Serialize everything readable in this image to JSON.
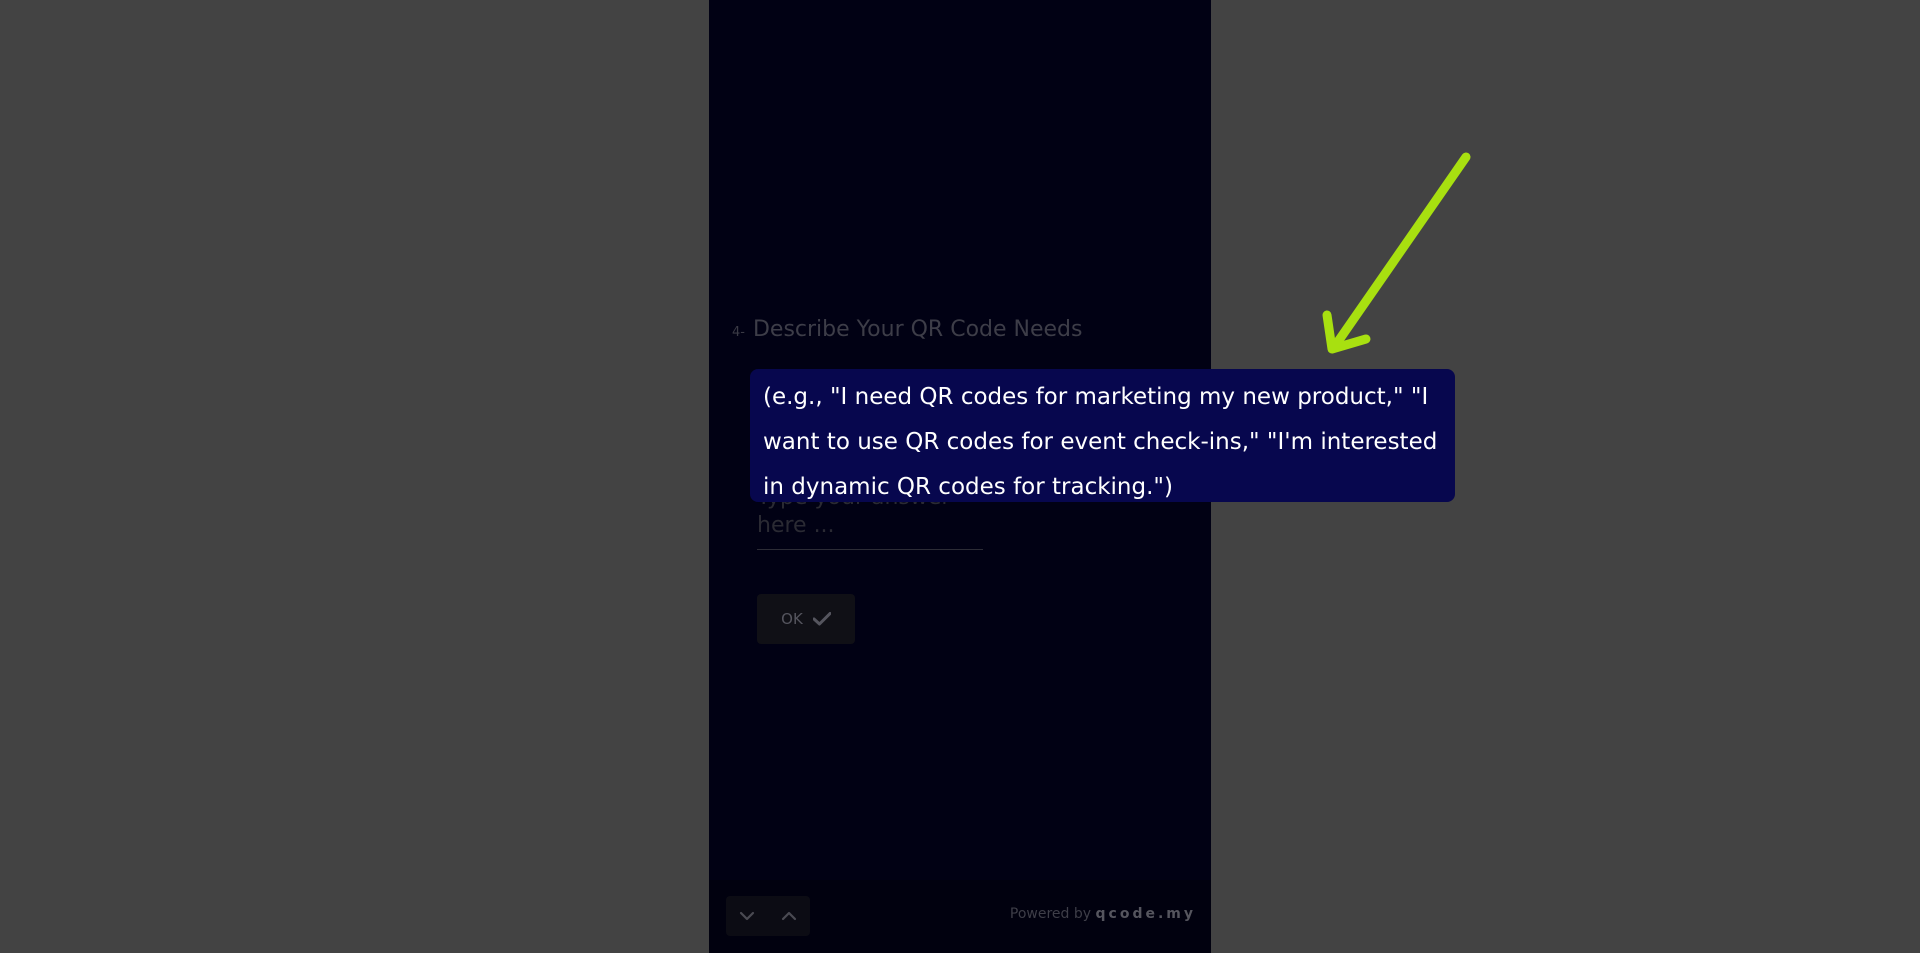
{
  "question": {
    "number": "4-",
    "title": "Describe Your QR Code Needs"
  },
  "answer": {
    "placeholder": "Type your answer here ..."
  },
  "ok_button": {
    "label": "OK",
    "icon": "check-icon"
  },
  "footer": {
    "powered_prefix": "Powered by",
    "brand": "qcode.my",
    "nav_down_icon": "chevron-down-icon",
    "nav_up_icon": "chevron-up-icon"
  },
  "tooltip": {
    "text": "(e.g., \"I need QR codes for marketing my new product,\" \"I want to use QR codes for event check-ins,\" \"I'm interested in dynamic QR codes for tracking.\")"
  },
  "colors": {
    "backdrop": "#434343",
    "panel": "#010114",
    "tooltip_bg": "#07074e",
    "arrow": "#a8e010"
  }
}
